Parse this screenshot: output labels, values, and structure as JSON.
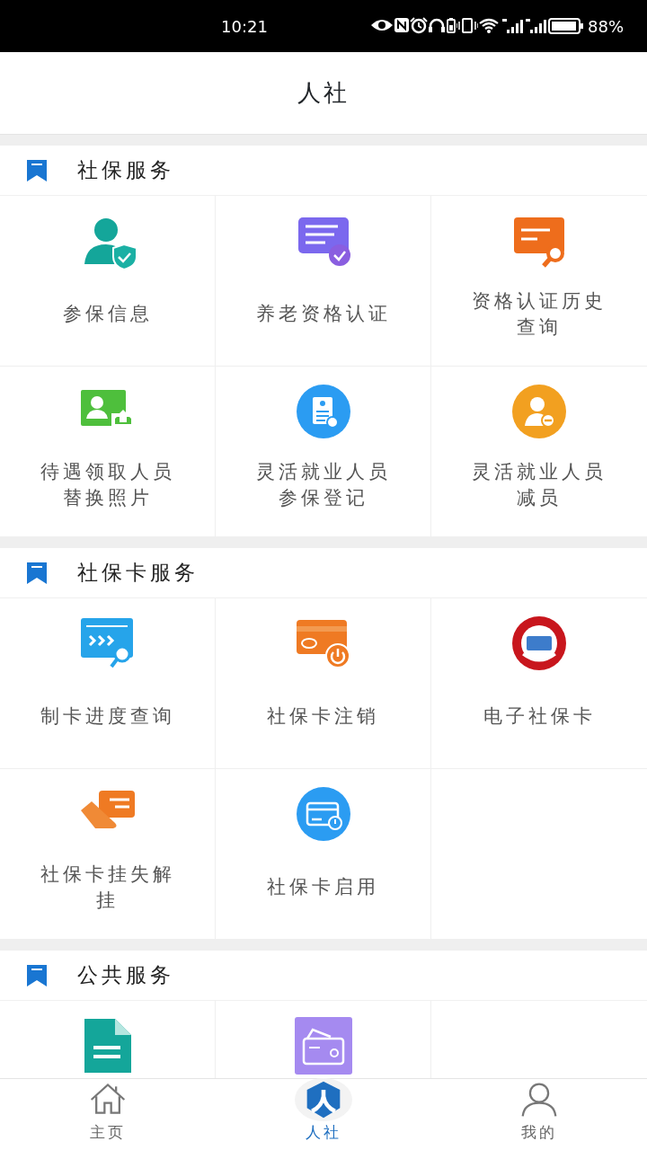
{
  "status_bar": {
    "time": "10:21",
    "battery": "88%"
  },
  "header": {
    "title": "人社"
  },
  "sections": [
    {
      "title": "社保服务",
      "items": [
        {
          "kind": "person-shield",
          "label": "参保信息"
        },
        {
          "kind": "doc-badge",
          "label": "养老资格认证"
        },
        {
          "kind": "doc-search",
          "label": "资格认证历史查询"
        },
        {
          "kind": "photo-upload",
          "label": "待遇领取人员替换照片"
        },
        {
          "kind": "register",
          "label": "灵活就业人员参保登记"
        },
        {
          "kind": "person-minus",
          "label": "灵活就业人员减员"
        }
      ]
    },
    {
      "title": "社保卡服务",
      "items": [
        {
          "kind": "progress-search",
          "label": "制卡进度查询"
        },
        {
          "kind": "card-power",
          "label": "社保卡注销"
        },
        {
          "kind": "emblem",
          "label": "电子社保卡"
        },
        {
          "kind": "hand-card",
          "label": "社保卡挂失解挂"
        },
        {
          "kind": "card-circle",
          "label": "社保卡启用"
        }
      ]
    },
    {
      "title": "公共服务",
      "items": [
        {
          "kind": "file"
        },
        {
          "kind": "wallet"
        }
      ]
    }
  ],
  "bottom_nav": [
    {
      "kind": "home",
      "label": "主页",
      "selected": false
    },
    {
      "kind": "hrss",
      "label": "人社",
      "selected": true
    },
    {
      "kind": "user",
      "label": "我的",
      "selected": false
    }
  ]
}
